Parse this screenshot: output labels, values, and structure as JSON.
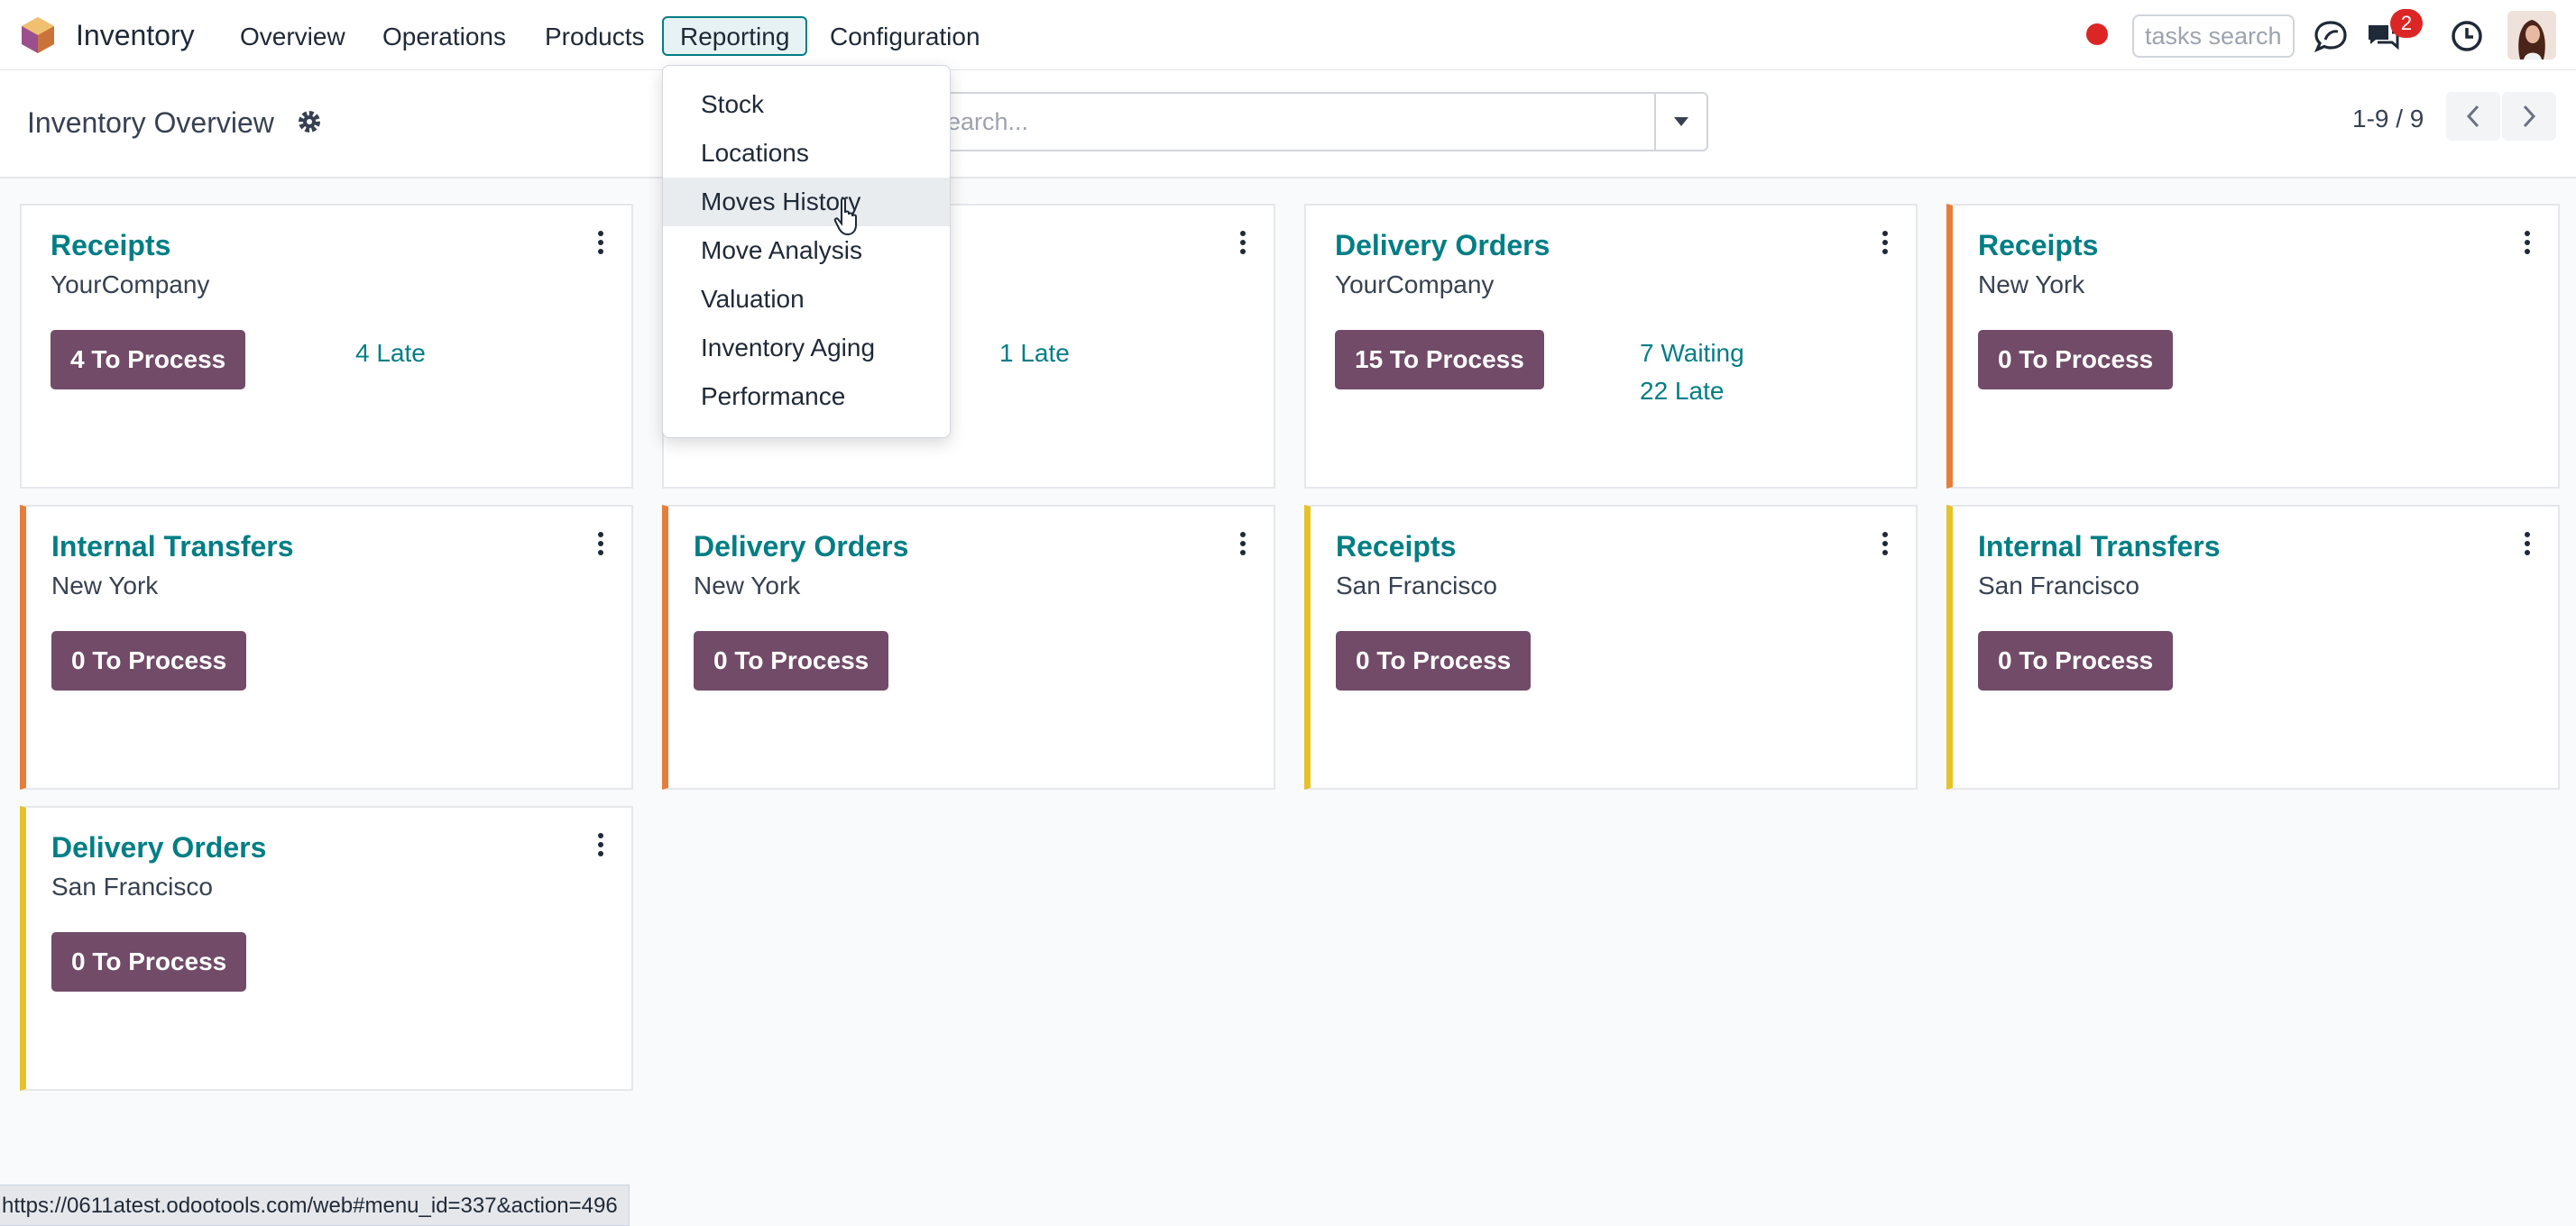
{
  "app": {
    "name": "Inventory"
  },
  "nav": {
    "items": [
      {
        "label": "Overview"
      },
      {
        "label": "Operations"
      },
      {
        "label": "Products"
      },
      {
        "label": "Reporting"
      },
      {
        "label": "Configuration"
      }
    ],
    "active": "Reporting"
  },
  "topbar": {
    "tasks_search_placeholder": "tasks search",
    "message_count": "2"
  },
  "control": {
    "title": "Inventory Overview",
    "search_placeholder": "Search...",
    "pager": "1-9 / 9"
  },
  "reporting_menu": {
    "items": [
      {
        "label": "Stock"
      },
      {
        "label": "Locations"
      },
      {
        "label": "Moves History"
      },
      {
        "label": "Move Analysis"
      },
      {
        "label": "Valuation"
      },
      {
        "label": "Inventory Aging"
      },
      {
        "label": "Performance"
      }
    ],
    "hovered": "Moves History"
  },
  "cards": [
    {
      "title": "Receipts",
      "subtitle": "YourCompany",
      "button": "4 To Process",
      "links": [
        "4 Late"
      ],
      "accent": "none"
    },
    {
      "title": "",
      "subtitle": "",
      "button": "",
      "links": [
        "1 Late"
      ],
      "accent": "none"
    },
    {
      "title": "Delivery Orders",
      "subtitle": "YourCompany",
      "button": "15 To Process",
      "links": [
        "7 Waiting",
        "22 Late"
      ],
      "accent": "none"
    },
    {
      "title": "Receipts",
      "subtitle": "New York",
      "button": "0 To Process",
      "links": [],
      "accent": "#e67e3a"
    },
    {
      "title": "Internal Transfers",
      "subtitle": "New York",
      "button": "0 To Process",
      "links": [],
      "accent": "#e67e3a"
    },
    {
      "title": "Delivery Orders",
      "subtitle": "New York",
      "button": "0 To Process",
      "links": [],
      "accent": "#e67e3a"
    },
    {
      "title": "Receipts",
      "subtitle": "San Francisco",
      "button": "0 To Process",
      "links": [],
      "accent": "#e6c229"
    },
    {
      "title": "Internal Transfers",
      "subtitle": "San Francisco",
      "button": "0 To Process",
      "links": [],
      "accent": "#e6c229"
    },
    {
      "title": "Delivery Orders",
      "subtitle": "San Francisco",
      "button": "0 To Process",
      "links": [],
      "accent": "#e6c229"
    }
  ],
  "status_bar": {
    "url": "https://0611atest.odootools.com/web#menu_id=337&action=496"
  },
  "colors": {
    "brand_teal": "#017e84",
    "button_purple": "#714b67",
    "accent_orange": "#e67e3a",
    "accent_yellow": "#e6c229",
    "notification_red": "#dc2626"
  },
  "icons": [
    "app-logo-icon",
    "gear-icon",
    "caret-down-icon",
    "chevron-left-icon",
    "chevron-right-icon",
    "record-dot-icon",
    "chat-bubble-icon",
    "messages-icon",
    "clock-icon",
    "kebab-menu-icon",
    "hand-cursor-icon"
  ]
}
